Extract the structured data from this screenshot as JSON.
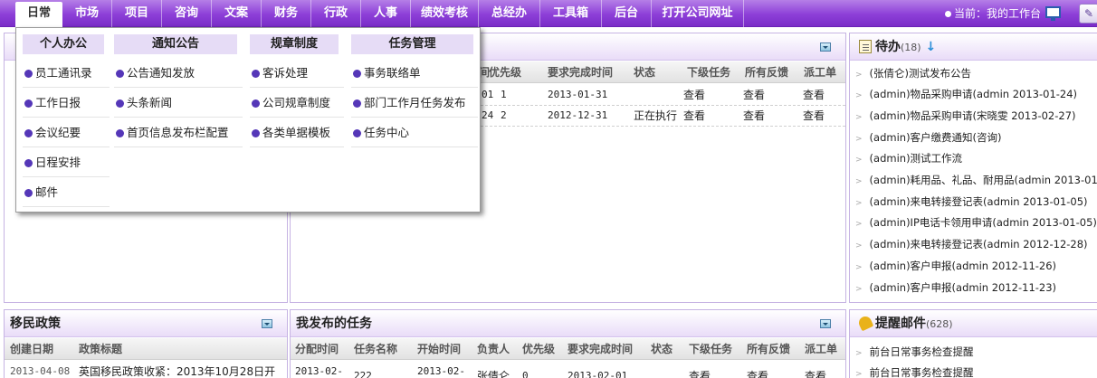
{
  "topnav": {
    "items": [
      "日常",
      "市场",
      "项目",
      "咨询",
      "文案",
      "财务",
      "行政",
      "人事",
      "绩效考核",
      "总经办",
      "工具箱",
      "后台",
      "打开公司网址"
    ],
    "active_index": 0,
    "current_location": "当前：我的工作台",
    "pencil_glyph": "✎"
  },
  "dropdown": {
    "columns": [
      {
        "title": "个人办公",
        "items": [
          "员工通讯录",
          "工作日报",
          "会议纪要",
          "日程安排",
          "邮件"
        ]
      },
      {
        "title": "通知公告",
        "items": [
          "公告通知发放",
          "头条新闻",
          "首页信息发布栏配置"
        ]
      },
      {
        "title": "规章制度",
        "items": [
          "客诉处理",
          "公司规章制度",
          "各类单据模板"
        ]
      },
      {
        "title": "任务管理",
        "items": [
          "事务联络单",
          "部门工作月任务发布",
          "任务中心"
        ]
      }
    ]
  },
  "task_panel": {
    "headers": [
      "间",
      "优先级",
      "要求完成时间",
      "状态",
      "下级任务",
      "所有反馈",
      "派工单"
    ],
    "rows": [
      {
        "a": "01",
        "priority": "1",
        "due": "2013-01-31",
        "status": "",
        "sub": "查看",
        "feedback": "查看",
        "dispatch": "查看"
      },
      {
        "a": "24",
        "priority": "2",
        "due": "2012-12-31",
        "status": "正在执行",
        "sub": "查看",
        "feedback": "查看",
        "dispatch": "查看"
      }
    ]
  },
  "todo": {
    "title": "待办",
    "count": "(18)",
    "items": [
      "(张倩仑)测试发布公告",
      "(admin)物品采购申请(admin 2013-01-24)",
      "(admin)物品采购申请(宋晓雯 2013-02-27)",
      "(admin)客户缴费通知(咨询)",
      "(admin)测试工作流",
      "(admin)耗用品、礼品、耐用品(admin 2013-01-",
      "(admin)来电转接登记表(admin 2013-01-05)",
      "(admin)IP电话卡领用申请(admin 2013-01-05)",
      "(admin)来电转接登记表(admin 2012-12-28)",
      "(admin)客户申报(admin 2012-11-26)",
      "(admin)客户申报(admin 2012-11-23)"
    ]
  },
  "immigration": {
    "title": "移民政策",
    "headers": [
      "创建日期",
      "政策标题"
    ],
    "row": {
      "date": "2013-04-08",
      "title": "英国移民政策收紧：2013年10月28日开"
    }
  },
  "my_tasks": {
    "title": "我发布的任务",
    "headers": [
      "分配时间",
      "任务名称",
      "开始时间",
      "负责人",
      "优先级",
      "要求完成时间",
      "状态",
      "下级任务",
      "所有反馈",
      "派工单"
    ],
    "row": {
      "assigned": "2013-02-",
      "name": "222",
      "start": "2013-02-",
      "owner": "张倩仑",
      "priority": "0",
      "due": "2013-02-01",
      "status": "",
      "sub": "查看",
      "feedback": "查看",
      "dispatch": "查看"
    }
  },
  "reminder_mail": {
    "title": "提醒邮件",
    "count": "(628)",
    "items": [
      "前台日常事务检查提醒",
      "前台日常事务检查提醒"
    ]
  },
  "colors": {
    "nav_purple": "#8d3fd8",
    "bullet_purple": "#5537b8",
    "panel_border": "#c6b3e3"
  }
}
